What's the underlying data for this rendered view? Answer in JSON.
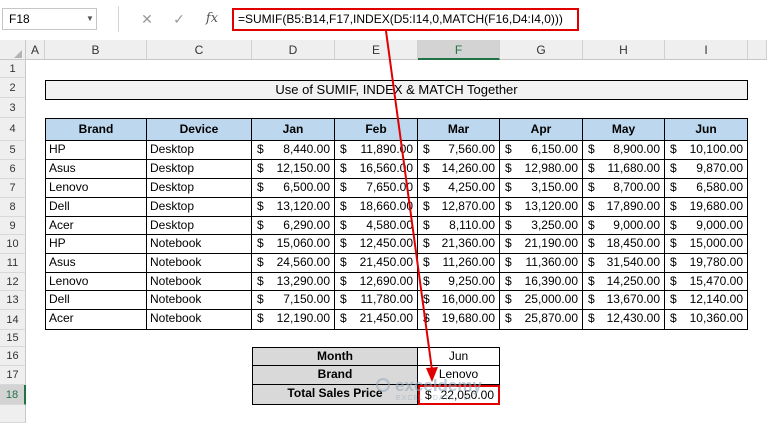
{
  "formula_bar": {
    "name_box": "F18",
    "cancel_glyph": "✕",
    "enter_glyph": "✓",
    "fx_label": "fx",
    "formula": "=SUMIF(B5:B14,F17,INDEX(D5:I14,0,MATCH(F16,D4:I4,0)))"
  },
  "columns": [
    "A",
    "B",
    "C",
    "D",
    "E",
    "F",
    "G",
    "H",
    "I"
  ],
  "selected_column": "F",
  "rows": [
    "1",
    "2",
    "3",
    "4",
    "5",
    "6",
    "7",
    "8",
    "9",
    "10",
    "11",
    "12",
    "13",
    "14",
    "15",
    "16",
    "17",
    "18"
  ],
  "selected_row": "18",
  "title": "Use of SUMIF, INDEX & MATCH Together",
  "table": {
    "headers": [
      "Brand",
      "Device",
      "Jan",
      "Feb",
      "Mar",
      "Apr",
      "May",
      "Jun"
    ],
    "currency_symbol": "$",
    "rows": [
      {
        "brand": "HP",
        "device": "Desktop",
        "values": [
          "8,440.00",
          "11,890.00",
          "7,560.00",
          "6,150.00",
          "8,900.00",
          "10,100.00"
        ]
      },
      {
        "brand": "Asus",
        "device": "Desktop",
        "values": [
          "12,150.00",
          "16,560.00",
          "14,260.00",
          "12,980.00",
          "11,680.00",
          "9,870.00"
        ]
      },
      {
        "brand": "Lenovo",
        "device": "Desktop",
        "values": [
          "6,500.00",
          "7,650.00",
          "4,250.00",
          "3,150.00",
          "8,700.00",
          "6,580.00"
        ]
      },
      {
        "brand": "Dell",
        "device": "Desktop",
        "values": [
          "13,120.00",
          "18,660.00",
          "12,870.00",
          "13,120.00",
          "17,890.00",
          "19,680.00"
        ]
      },
      {
        "brand": "Acer",
        "device": "Desktop",
        "values": [
          "6,290.00",
          "4,580.00",
          "8,110.00",
          "3,250.00",
          "9,000.00",
          "9,000.00"
        ]
      },
      {
        "brand": "HP",
        "device": "Notebook",
        "values": [
          "15,060.00",
          "12,450.00",
          "21,360.00",
          "21,190.00",
          "18,450.00",
          "15,000.00"
        ]
      },
      {
        "brand": "Asus",
        "device": "Notebook",
        "values": [
          "24,560.00",
          "21,450.00",
          "11,260.00",
          "11,360.00",
          "31,540.00",
          "19,780.00"
        ]
      },
      {
        "brand": "Lenovo",
        "device": "Notebook",
        "values": [
          "13,290.00",
          "12,690.00",
          "9,250.00",
          "16,390.00",
          "14,250.00",
          "15,470.00"
        ]
      },
      {
        "brand": "Dell",
        "device": "Notebook",
        "values": [
          "7,150.00",
          "11,780.00",
          "16,000.00",
          "25,000.00",
          "13,670.00",
          "12,140.00"
        ]
      },
      {
        "brand": "Acer",
        "device": "Notebook",
        "values": [
          "12,190.00",
          "21,450.00",
          "19,680.00",
          "25,870.00",
          "12,430.00",
          "10,360.00"
        ]
      }
    ]
  },
  "lookup": {
    "month_label": "Month",
    "month_value": "Jun",
    "brand_label": "Brand",
    "brand_value": "Lenovo",
    "total_label": "Total Sales Price",
    "total_symbol": "$",
    "total_value": "22,050.00"
  },
  "watermark": {
    "name": "exceldemy",
    "tagline": "EXCEL · DATA · BI"
  },
  "colors": {
    "header_fill": "#bdd7ee",
    "highlight": "#e00000",
    "selection": "#217346"
  }
}
